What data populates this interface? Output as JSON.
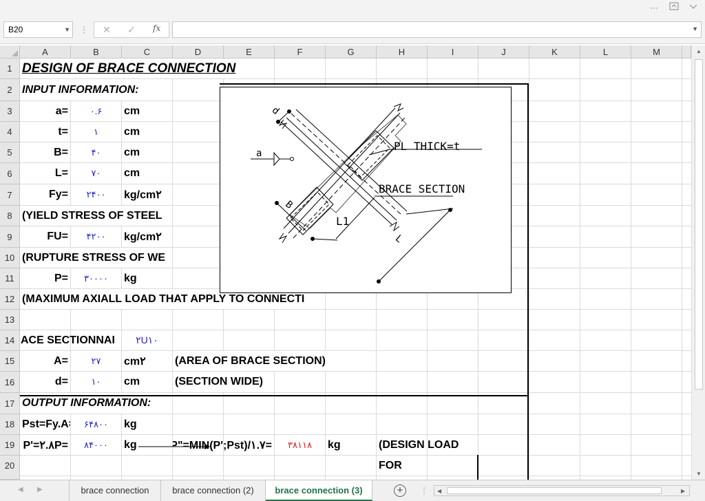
{
  "window": {
    "more_label": "···"
  },
  "formula_bar": {
    "cell_ref": "B20",
    "cancel_icon": "✕",
    "enter_icon": "✓",
    "fx_label": "fx",
    "formula": ""
  },
  "columns": [
    "A",
    "B",
    "C",
    "D",
    "E",
    "F",
    "G",
    "H",
    "I",
    "J",
    "K",
    "L",
    "M"
  ],
  "rows": [
    "1",
    "2",
    "3",
    "4",
    "5",
    "6",
    "7",
    "8",
    "9",
    "10",
    "11",
    "12",
    "13",
    "14",
    "15",
    "16",
    "17",
    "18",
    "19",
    "20"
  ],
  "cells": {
    "r1": {
      "a": "DESIGN OF BRACE CONNECTION"
    },
    "r2": {
      "a": "INPUT INFORMATION:"
    },
    "r3": {
      "label": "a=",
      "value": "۰.۶",
      "unit": "cm"
    },
    "r4": {
      "label": "t=",
      "value": "۱",
      "unit": "cm"
    },
    "r5": {
      "label": "B=",
      "value": "۴۰",
      "unit": "cm"
    },
    "r6": {
      "label": "L=",
      "value": "۷۰",
      "unit": "cm"
    },
    "r7": {
      "label": "Fy=",
      "value": "۲۴۰۰",
      "unit": "kg/cm۲"
    },
    "r8": {
      "note": "(YIELD STRESS OF STEEL"
    },
    "r9": {
      "label": "FU=",
      "value": "۴۲۰۰",
      "unit": "kg/cm۲"
    },
    "r10": {
      "note": "(RUPTURE STRESS OF WE"
    },
    "r11": {
      "label": "P=",
      "value": "۳۰۰۰۰",
      "unit": "kg"
    },
    "r12": {
      "note": "(MAXIMUM AXIALL LOAD THAT APPLY TO CONNECTI"
    },
    "r14": {
      "label": "ACE SECTIONNAI",
      "value": "۲U۱۰"
    },
    "r15": {
      "label": "A=",
      "value": "۲۷",
      "unit": "cm۲",
      "note": "(AREA OF BRACE SECTION)"
    },
    "r16": {
      "label": "d=",
      "value": "۱۰",
      "unit": "cm",
      "note": "(SECTION WIDE)"
    },
    "r17": {
      "a": "OUTPUT INFORMATION:"
    },
    "r18": {
      "label": "Pst=Fy.A=",
      "value": "۶۴۸۰۰",
      "unit": "kg"
    },
    "r19": {
      "label": "P'=۲.۸P=",
      "value": "۸۴۰۰۰",
      "unit": "kg",
      "formula_label": "P\"=MIN(P';Pst)/۱.۷=",
      "result": "۳۸۱۱۸",
      "result_unit": "kg",
      "design_note": "(DESIGN  LOAD"
    },
    "r20": {
      "design_note2": "FOR"
    }
  },
  "drawing": {
    "labels": {
      "pl": "PL THICK=t",
      "brace": "BRACE SECTION",
      "a": "a",
      "b": "B",
      "d": "d",
      "l1": "L1",
      "l": "L"
    }
  },
  "sheets": [
    {
      "label": "brace connection",
      "active": false
    },
    {
      "label": "brace connection  (2)",
      "active": false
    },
    {
      "label": "brace connection  (3)",
      "active": true
    }
  ],
  "sheet_add_label": "+"
}
